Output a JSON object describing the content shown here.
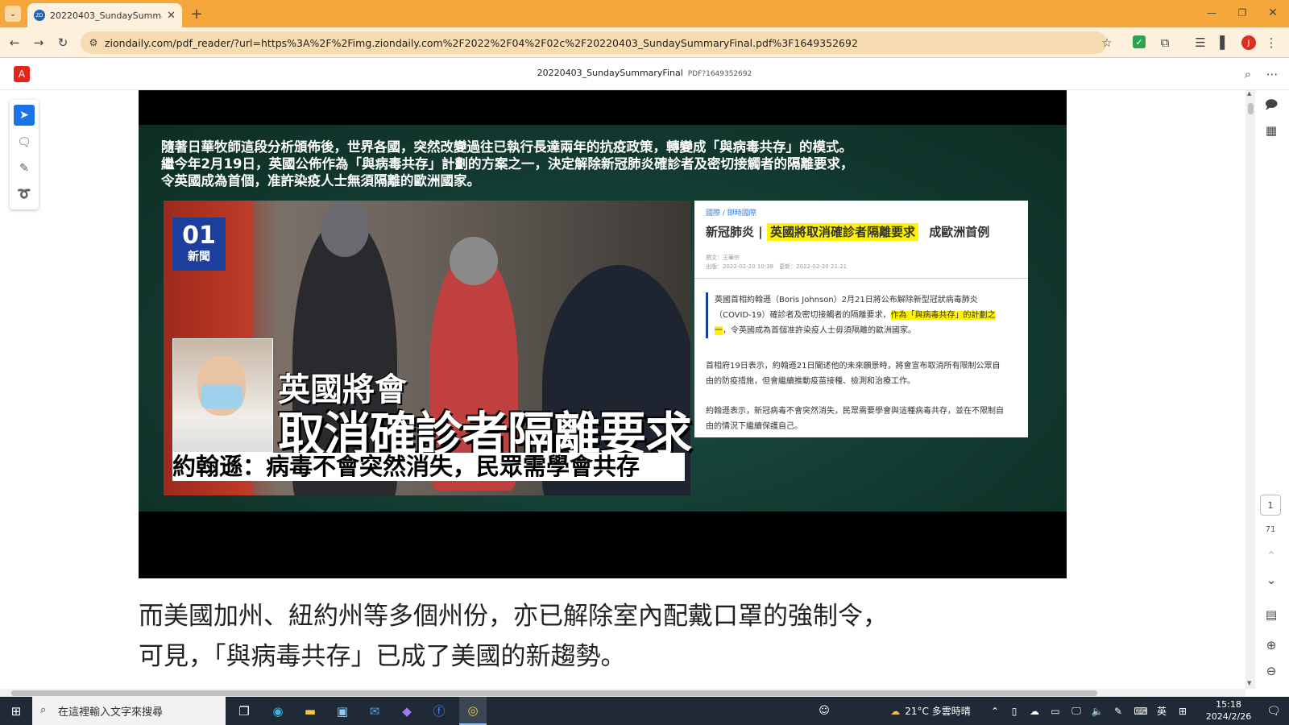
{
  "browser": {
    "tab_title": "20220403_SundaySummaryF",
    "favicon_text": "ZD",
    "url": "ziondaily.com/pdf_reader/?url=https%3A%2F%2Fimg.ziondaily.com%2F2022%2F04%2F02c%2F20220403_SundaySummaryFinal.pdf%3F1649352692",
    "profile_initial": "J"
  },
  "pdf": {
    "title": "20220403_SundaySummaryFinal",
    "subtitle": "PDF?1649352692",
    "current_page": "1",
    "total_pages": "71"
  },
  "slide": {
    "caption": [
      "隨著日華牧師這段分析頒佈後，世界各國，突然改變過往已執行長達兩年的抗疫政策，轉變成「與病毒共存」的模式。",
      "繼今年2月19日，英國公佈作為「與病毒共存」計劃的方案之一，決定解除新冠肺炎確診者及密切接觸者的隔離要求，",
      "令英國成為首個，准許染疫人士無須隔離的歐洲國家。"
    ],
    "logo_top": "01",
    "logo_bottom": "新聞",
    "headline_1": "英國將會",
    "headline_2": "取消確診者隔離要求",
    "headline_3": "約翰遜：病毒不會突然消失，民眾需學會共存",
    "news": {
      "crumb_1": "國際",
      "crumb_2": "即時國際",
      "title_prefix": "新冠肺炎 |",
      "title_highlight": "英國將取消確診者隔離要求",
      "title_suffix": "成歐洲首例",
      "author": "撰文：王華宗",
      "dates": "出版：2022-02-20 10:38　更新：2022-02-20 21:21",
      "para1_a": "英國首相約翰遜（Boris Johnson）2月21日將公布解除新型冠狀病毒肺炎（COVID-19）確診者及密切接觸者的隔離要求，",
      "para1_hl": "作為「與病毒共存」的計劃之一",
      "para1_b": "，令英國成為首個准許染疫人士毋須隔離的歐洲國家。",
      "para2": "首相府19日表示，約翰遜21日闡述他的未來願景時，將會宣布取消所有限制公眾自由的防疫措施，但會繼續推動疫苗接種、檢測和治療工作。",
      "para3": "約翰遜表示，新冠病毒不會突然消失，民眾需要學會與這種病毒共存，並在不限制自由的情況下繼續保護自己。"
    }
  },
  "body_text": [
    "而美國加州、紐約州等多個州份，亦已解除室內配戴口罩的強制令，",
    "可見，「與病毒共存」已成了美國的新趨勢。"
  ],
  "taskbar": {
    "search_placeholder": "在這裡輸入文字來搜尋",
    "weather": "21°C  多雲時晴",
    "ime": "英",
    "time": "15:18",
    "date": "2024/2/26"
  },
  "colors": {
    "tabbar": "#f6a73b",
    "accent": "#1a73e8",
    "highlight": "#fff200"
  }
}
